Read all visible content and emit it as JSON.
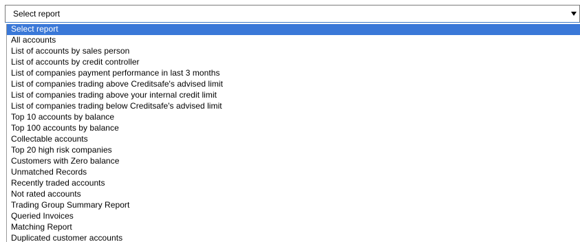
{
  "select": {
    "value": "Select report",
    "arrow_icon": "triangle-down",
    "highlight_color": "#3a78d8"
  },
  "options": [
    "Select report",
    "All accounts",
    "List of accounts by sales person",
    "List of accounts by credit controller",
    "List of companies payment performance in last 3 months",
    "List of companies trading above Creditsafe's advised limit",
    "List of companies trading above your internal credit limit",
    "List of companies trading below Creditsafe's advised limit",
    "Top 10 accounts by balance",
    "Top 100 accounts by balance",
    "Collectable accounts",
    "Top 20 high risk companies",
    "Customers with Zero balance",
    "Unmatched Records",
    "Recently traded accounts",
    "Not rated accounts",
    "Trading Group Summary Report",
    "Queried Invoices",
    "Matching Report",
    "Duplicated customer accounts"
  ],
  "selected_index": 0
}
